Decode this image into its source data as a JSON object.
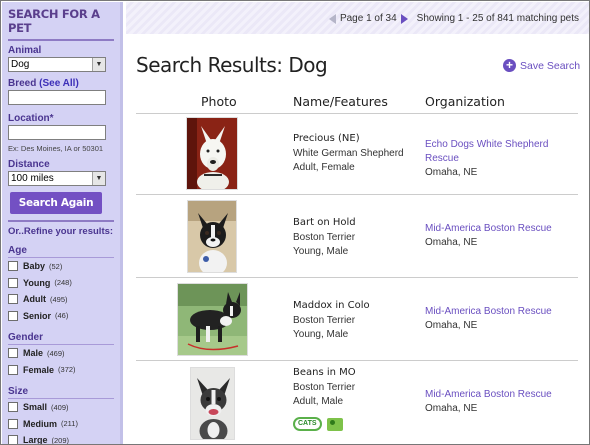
{
  "sidebar": {
    "title": "SEARCH FOR A PET",
    "animal_label": "Animal",
    "animal_value": "Dog",
    "breed_label": "Breed",
    "breed_link": "(See All)",
    "location_label": "Location*",
    "location_hint": "Ex: Des Moines, IA or 50301",
    "distance_label": "Distance",
    "distance_value": "100 miles",
    "search_button": "Search Again",
    "refine_label": "Or..Refine your results:",
    "age": {
      "label": "Age",
      "options": [
        {
          "label": "Baby",
          "count": "(52)"
        },
        {
          "label": "Young",
          "count": "(248)"
        },
        {
          "label": "Adult",
          "count": "(495)"
        },
        {
          "label": "Senior",
          "count": "(46)"
        }
      ]
    },
    "gender": {
      "label": "Gender",
      "options": [
        {
          "label": "Male",
          "count": "(469)"
        },
        {
          "label": "Female",
          "count": "(372)"
        }
      ]
    },
    "size": {
      "label": "Size",
      "options": [
        {
          "label": "Small",
          "count": "(409)"
        },
        {
          "label": "Medium",
          "count": "(211)"
        },
        {
          "label": "Large",
          "count": "(209)"
        }
      ]
    }
  },
  "pager": {
    "page_text": "Page 1 of 34",
    "showing_text": "Showing 1 - 25 of 841 matching pets"
  },
  "main": {
    "title": "Search Results: Dog",
    "save_search": "Save Search",
    "columns": [
      "Photo",
      "Name/Features",
      "Organization"
    ],
    "results": [
      {
        "name": "Precious (NE)",
        "breed": "White German Shepherd",
        "meta": "Adult, Female",
        "org": "Echo Dogs White Shepherd Rescue",
        "city": "Omaha, NE"
      },
      {
        "name": "Bart on Hold",
        "breed": "Boston Terrier",
        "meta": "Young, Male",
        "org": "Mid-America Boston Rescue",
        "city": "Omaha, NE"
      },
      {
        "name": "Maddox in Colo",
        "breed": "Boston Terrier",
        "meta": "Young, Male",
        "org": "Mid-America Boston Rescue",
        "city": "Omaha, NE"
      },
      {
        "name": "Beans in MO",
        "breed": "Boston Terrier",
        "meta": "Adult, Male",
        "org": "Mid-America Boston Rescue",
        "city": "Omaha, NE",
        "badge": "CATS"
      }
    ]
  },
  "colors": {
    "sidebar_bg": "#d4d2f4",
    "accent": "#6a4fc0",
    "button": "#7350c3"
  }
}
